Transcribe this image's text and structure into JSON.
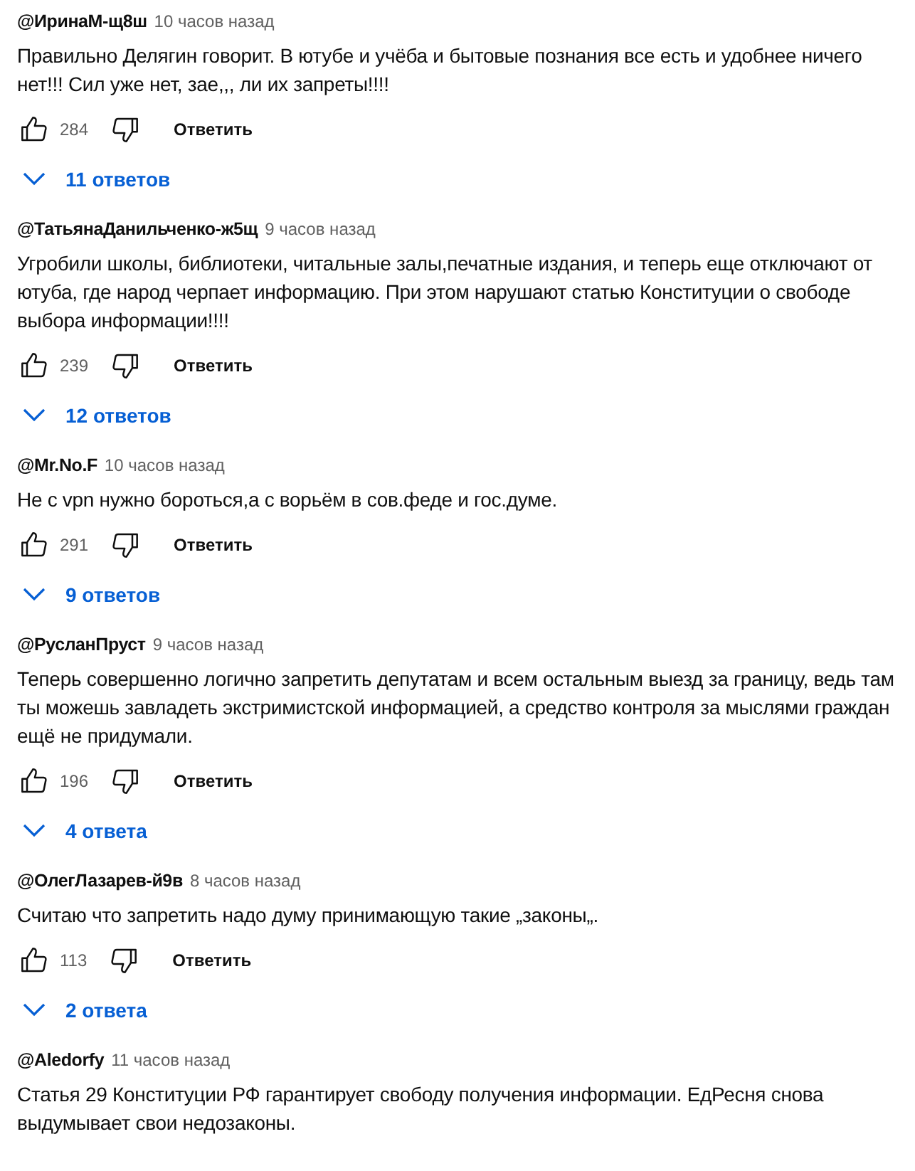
{
  "comments": [
    {
      "author": "@ИринаМ-щ8ш",
      "time": "10 часов назад",
      "text": "Правильно Делягин говорит. В ютубе и учёба и бытовые познания все есть и удобнее ничего нет!!! Сил уже нет, зае,,, ли их запреты!!!!",
      "likes": "284",
      "reply_label": "Ответить",
      "replies": "11 ответов"
    },
    {
      "author": "@ТатьянаДанильченко-ж5щ",
      "time": "9 часов назад",
      "text": "Угробили школы, библиотеки, читальные залы,печатные издания, и теперь еще отключают от ютуба, где народ черпает информацию. При этом нарушают статью Конституции о свободе выбора информации!!!!",
      "likes": "239",
      "reply_label": "Ответить",
      "replies": "12 ответов"
    },
    {
      "author": "@Mr.No.F",
      "time": "10 часов назад",
      "text": "Не с vpn нужно бороться,а с ворьём в сов.феде и гос.думе.",
      "likes": "291",
      "reply_label": "Ответить",
      "replies": "9 ответов"
    },
    {
      "author": "@РусланПруст",
      "time": "9 часов назад",
      "text": "Теперь совершенно логично запретить депутатам и всем остальным выезд за границу, ведь там ты можешь завладеть экстримистской информацией, а средство контроля за мыслями граждан ещё не придумали.",
      "likes": "196",
      "reply_label": "Ответить",
      "replies": "4 ответа"
    },
    {
      "author": "@ОлегЛазарев-й9в",
      "time": "8 часов назад",
      "text": "Считаю что запретить надо думу принимающую такие „законы„.",
      "likes": "113",
      "reply_label": "Ответить",
      "replies": "2 ответа"
    },
    {
      "author": "@Aledorfy",
      "time": "11 часов назад",
      "text": "Статья 29 Конституции РФ гарантирует свободу получения информации. ЕдРесня снова выдумывает свои недозаконы."
    }
  ]
}
